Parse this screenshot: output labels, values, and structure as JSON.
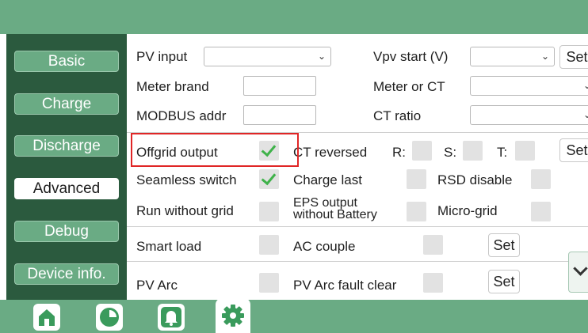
{
  "sidebar": {
    "items": [
      {
        "label": "Basic"
      },
      {
        "label": "Charge"
      },
      {
        "label": "Discharge"
      },
      {
        "label": "Advanced",
        "active": true
      },
      {
        "label": "Debug"
      },
      {
        "label": "Device info."
      }
    ]
  },
  "form": {
    "pv_input": {
      "label": "PV input",
      "value": ""
    },
    "vpv_start": {
      "label": "Vpv start (V)",
      "value": "",
      "set_label": "Set"
    },
    "meter_brand": {
      "label": "Meter brand",
      "value": ""
    },
    "meter_or_ct": {
      "label": "Meter or CT",
      "value": ""
    },
    "modbus_addr": {
      "label": "MODBUS addr",
      "value": ""
    },
    "ct_ratio": {
      "label": "CT ratio",
      "value": ""
    },
    "offgrid_output": {
      "label": "Offgrid output",
      "checked": true
    },
    "ct_reversed": {
      "label": "CT reversed",
      "r": "R:",
      "s": "S:",
      "t": "T:",
      "set_label": "Set"
    },
    "seamless_switch": {
      "label": "Seamless switch",
      "checked": true
    },
    "charge_last": {
      "label": "Charge last",
      "checked": false
    },
    "rsd_disable": {
      "label": "RSD disable",
      "checked": false
    },
    "run_without_grid": {
      "label": "Run without grid",
      "checked": false
    },
    "eps_output": {
      "label_line1": "EPS output",
      "label_line2": "without Battery",
      "checked": false
    },
    "micro_grid": {
      "label": "Micro-grid",
      "checked": false
    },
    "smart_load": {
      "label": "Smart load",
      "checked": false
    },
    "ac_couple": {
      "label": "AC couple",
      "checked": false,
      "set_label": "Set"
    },
    "pv_arc": {
      "label": "PV Arc",
      "checked": false
    },
    "pv_arc_fault_clear": {
      "label": "PV Arc fault clear",
      "checked": false,
      "set_label": "Set"
    }
  },
  "bottom_tabs": [
    "home-icon",
    "pie-chart-icon",
    "bell-icon",
    "gear-icon"
  ],
  "colors": {
    "accent": "#6aab84",
    "sidebar": "#2b5a3e",
    "highlight": "#e02626",
    "check": "#3fb24a"
  }
}
